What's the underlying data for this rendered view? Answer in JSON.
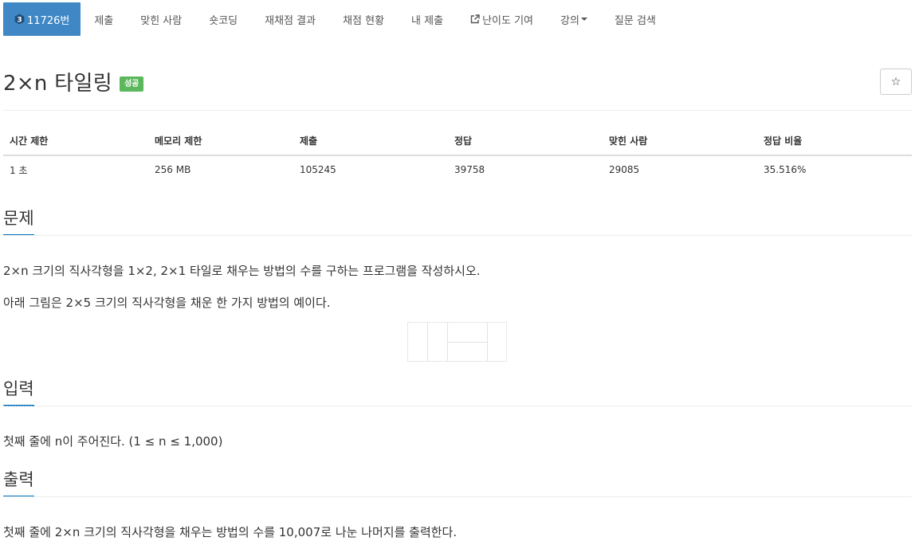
{
  "nav": {
    "problem_tab": {
      "tier_number": "3",
      "label": "11726번"
    },
    "items": [
      {
        "label": "제출"
      },
      {
        "label": "맞힌 사람"
      },
      {
        "label": "숏코딩"
      },
      {
        "label": "재채점 결과"
      },
      {
        "label": "채점 현황"
      },
      {
        "label": "내 제출"
      },
      {
        "label": "난이도 기여",
        "icon": "external-link-icon"
      },
      {
        "label": "강의",
        "icon": "caret-down-icon"
      },
      {
        "label": "질문 검색"
      }
    ]
  },
  "problem": {
    "title": "2×n 타일링",
    "status_badge": "성공",
    "star": "☆"
  },
  "info_table": {
    "headers": [
      "시간 제한",
      "메모리 제한",
      "제출",
      "정답",
      "맞힌 사람",
      "정답 비율"
    ],
    "row": [
      "1 초",
      "256 MB",
      "105245",
      "39758",
      "29085",
      "35.516%"
    ]
  },
  "sections": {
    "description": {
      "heading": "문제",
      "paragraphs": [
        "2×n 크기의 직사각형을 1×2, 2×1 타일로 채우는 방법의 수를 구하는 프로그램을 작성하시오.",
        "아래 그림은 2×5 크기의 직사각형을 채운 한 가지 방법의 예이다."
      ]
    },
    "input": {
      "heading": "입력",
      "text": "첫째 줄에 n이 주어진다. (1 ≤ n ≤ 1,000)"
    },
    "output": {
      "heading": "출력",
      "text": "첫째 줄에 2×n 크기의 직사각형을 채우는 방법의 수를 10,007로 나눈 나머지를 출력한다."
    }
  },
  "colors": {
    "active_tab": "#3f88c5",
    "success_badge": "#5cb85c",
    "heading_underline": "#0076c0"
  }
}
